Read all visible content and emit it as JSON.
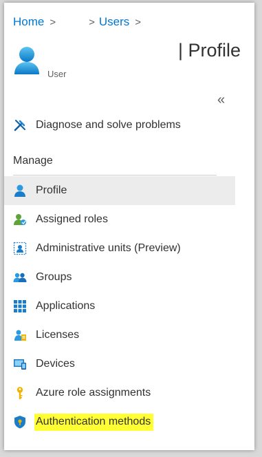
{
  "breadcrumb": {
    "home": "Home",
    "users": "Users"
  },
  "header": {
    "title": "| Profile",
    "user_subtitle": "User"
  },
  "sidebar": {
    "collapse_glyph": "«",
    "top_item": {
      "label": "Diagnose and solve problems",
      "icon": "wrench-icon"
    },
    "section_title": "Manage",
    "items": [
      {
        "label": "Profile",
        "icon": "person-icon",
        "selected": true
      },
      {
        "label": "Assigned roles",
        "icon": "assigned-roles-icon"
      },
      {
        "label": "Administrative units (Preview)",
        "icon": "admin-units-icon"
      },
      {
        "label": "Groups",
        "icon": "groups-icon"
      },
      {
        "label": "Applications",
        "icon": "applications-grid-icon"
      },
      {
        "label": "Licenses",
        "icon": "licenses-icon"
      },
      {
        "label": "Devices",
        "icon": "devices-icon"
      },
      {
        "label": "Azure role assignments",
        "icon": "key-icon"
      },
      {
        "label": "Authentication methods",
        "icon": "shield-icon",
        "highlighted": true
      }
    ]
  },
  "colors": {
    "link": "#0078d4",
    "selected_bg": "#ececec",
    "highlight": "#ffff33"
  }
}
